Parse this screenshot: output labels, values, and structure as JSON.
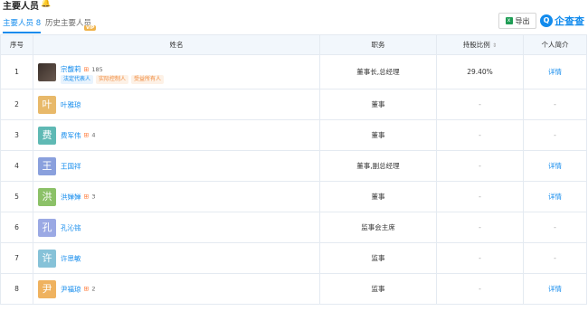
{
  "header": {
    "title": "主要人员"
  },
  "tabs": {
    "active_label": "主要人员",
    "active_count": "8",
    "history_label": "历史主要人员",
    "vip_badge": "VIP"
  },
  "toolbar": {
    "export_label": "导出",
    "excel_icon_text": "x",
    "brand_text": "企查查",
    "brand_logo_text": "Q"
  },
  "table": {
    "headers": {
      "index": "序号",
      "name": "姓名",
      "position": "职务",
      "share": "持股比例",
      "share_sort": "⇕",
      "profile": "个人简介"
    },
    "rows": [
      {
        "index": "1",
        "name": "宗馥莉",
        "avatar": "",
        "avatar_color": "",
        "boss_count": "185",
        "tags": [
          "法定代表人",
          "实际控制人",
          "受益所有人"
        ],
        "position": "董事长,总经理",
        "share": "29.40%",
        "profile": "详情"
      },
      {
        "index": "2",
        "name": "叶雅琼",
        "avatar": "叶",
        "avatar_color": "#e8b96a",
        "boss_count": "",
        "tags": [],
        "position": "董事",
        "share": "-",
        "profile": "-"
      },
      {
        "index": "3",
        "name": "费军伟",
        "avatar": "费",
        "avatar_color": "#5fb9b4",
        "boss_count": "4",
        "tags": [],
        "position": "董事",
        "share": "-",
        "profile": "-"
      },
      {
        "index": "4",
        "name": "王国祥",
        "avatar": "王",
        "avatar_color": "#8aa0dd",
        "boss_count": "",
        "tags": [],
        "position": "董事,副总经理",
        "share": "-",
        "profile": "详情"
      },
      {
        "index": "5",
        "name": "洪婵婵",
        "avatar": "洪",
        "avatar_color": "#8cc168",
        "boss_count": "3",
        "tags": [],
        "position": "董事",
        "share": "-",
        "profile": "详情"
      },
      {
        "index": "6",
        "name": "孔沁铭",
        "avatar": "孔",
        "avatar_color": "#9ba9e4",
        "boss_count": "",
        "tags": [],
        "position": "监事会主席",
        "share": "-",
        "profile": "-"
      },
      {
        "index": "7",
        "name": "许思敏",
        "avatar": "许",
        "avatar_color": "#86c2d8",
        "boss_count": "",
        "tags": [],
        "position": "监事",
        "share": "-",
        "profile": "-"
      },
      {
        "index": "8",
        "name": "尹福琼",
        "avatar": "尹",
        "avatar_color": "#efb25f",
        "boss_count": "2",
        "tags": [],
        "position": "监事",
        "share": "-",
        "profile": "详情"
      }
    ]
  }
}
